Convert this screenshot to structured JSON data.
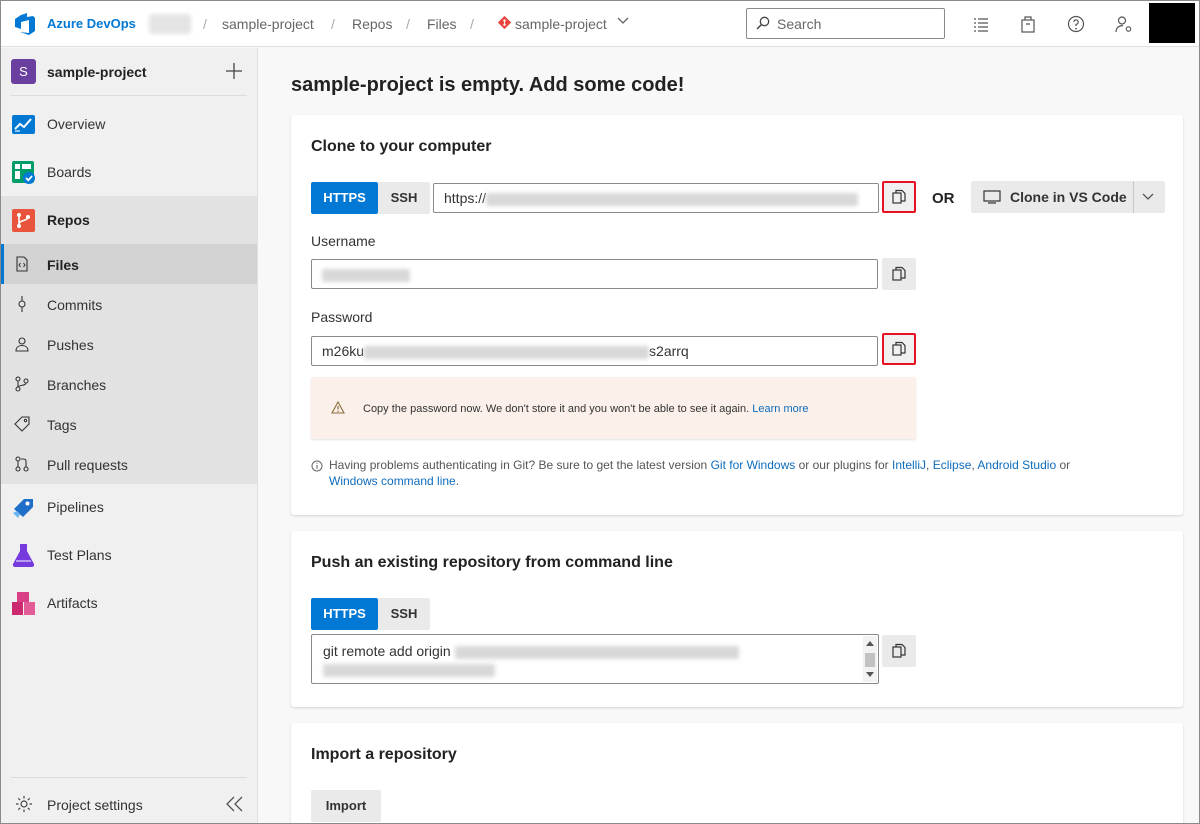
{
  "header": {
    "brand": "Azure DevOps",
    "breadcrumbs": [
      "sample-project",
      "Repos",
      "Files",
      "sample-project"
    ],
    "search_placeholder": "Search",
    "brand_color": "#0078d4"
  },
  "sidebar": {
    "project_initial": "S",
    "project_name": "sample-project",
    "items": [
      {
        "label": "Overview",
        "icon": "overview-icon"
      },
      {
        "label": "Boards",
        "icon": "boards-icon"
      },
      {
        "label": "Repos",
        "icon": "repos-icon"
      },
      {
        "label": "Files",
        "icon": "files-icon"
      },
      {
        "label": "Commits",
        "icon": "commits-icon"
      },
      {
        "label": "Pushes",
        "icon": "pushes-icon"
      },
      {
        "label": "Branches",
        "icon": "branches-icon"
      },
      {
        "label": "Tags",
        "icon": "tags-icon"
      },
      {
        "label": "Pull requests",
        "icon": "pull-requests-icon"
      },
      {
        "label": "Pipelines",
        "icon": "pipelines-icon"
      },
      {
        "label": "Test Plans",
        "icon": "test-plans-icon"
      },
      {
        "label": "Artifacts",
        "icon": "artifacts-icon"
      }
    ],
    "settings_label": "Project settings"
  },
  "main": {
    "title": "sample-project is empty. Add some code!",
    "clone": {
      "title": "Clone to your computer",
      "tab_https": "HTTPS",
      "tab_ssh": "SSH",
      "url_prefix": "https://",
      "or_label": "OR",
      "vscode_label": "Clone in VS Code",
      "username_label": "Username",
      "password_label": "Password",
      "password_start": "m26ku",
      "password_end": "s2arrq",
      "warning_text": "Copy the password now. We don't store it and you won't be able to see it again.",
      "warning_link": "Learn more",
      "help_prefix": "Having problems authenticating in Git? Be sure to get the latest version",
      "help_link_git": "Git for Windows",
      "help_mid": "or our plugins for",
      "help_link_intellij": "IntelliJ",
      "help_sep1": ",",
      "help_link_eclipse": "Eclipse",
      "help_sep2": ",",
      "help_link_studio": "Android Studio",
      "help_or": "or",
      "help_link_cmd": "Windows command line",
      "help_end": "."
    },
    "push": {
      "title": "Push an existing repository from command line",
      "tab_https": "HTTPS",
      "tab_ssh": "SSH",
      "command_prefix": "git remote add origin"
    },
    "import": {
      "title": "Import a repository",
      "button": "Import"
    }
  }
}
